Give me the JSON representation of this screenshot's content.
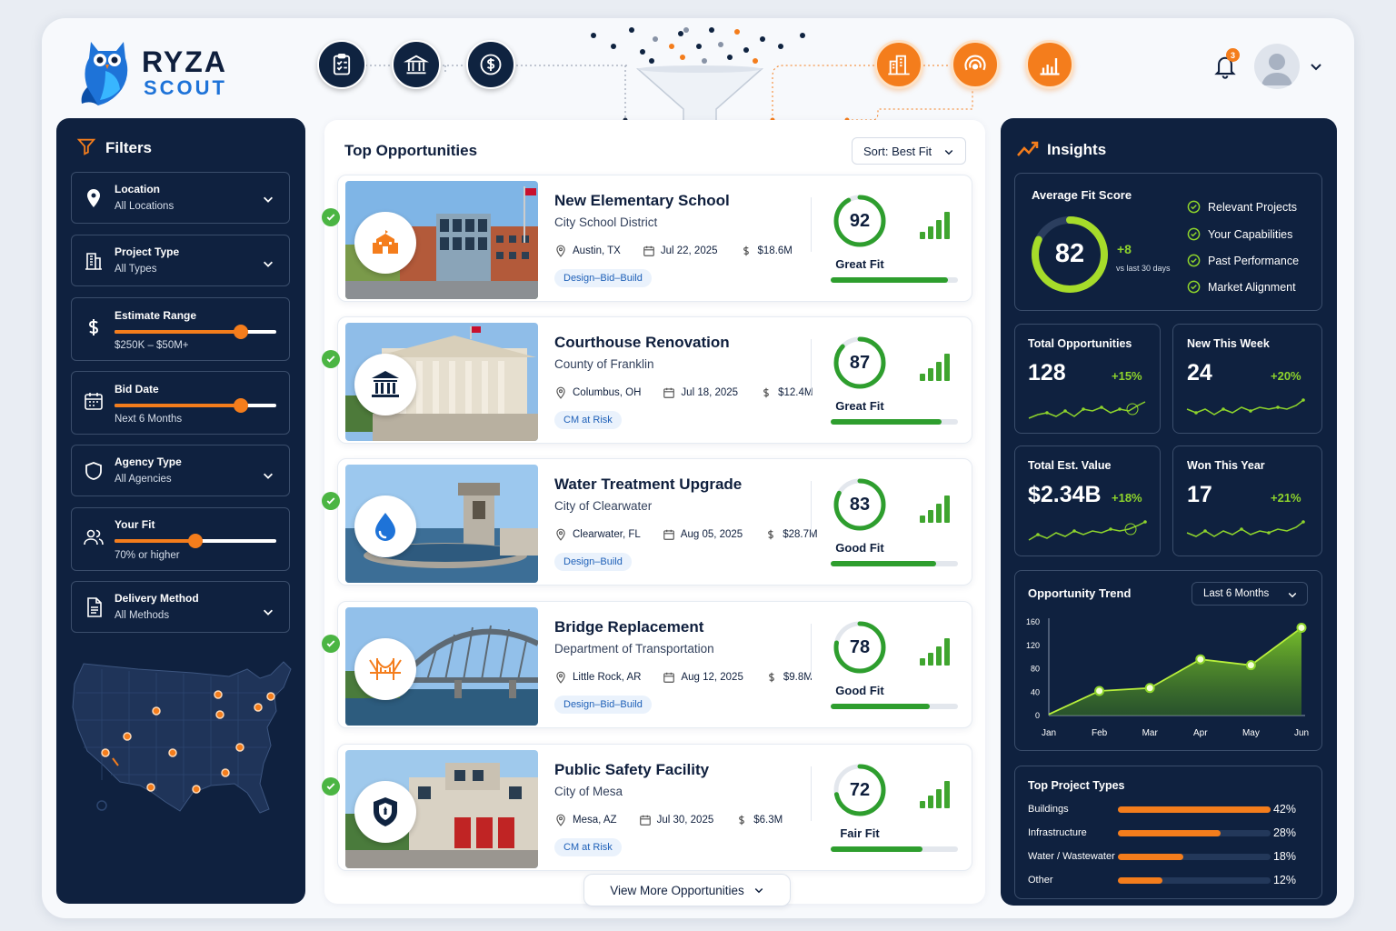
{
  "brand": {
    "name": "RYZA",
    "sub": "SCOUT"
  },
  "header": {
    "notifications_count": "3"
  },
  "filters": {
    "title": "Filters",
    "items": [
      {
        "label": "Location",
        "value": "All Locations"
      },
      {
        "label": "Project Type",
        "value": "All Types"
      },
      {
        "label": "Estimate Range",
        "value": "$250K – $50M+",
        "slider_position": 0.78
      },
      {
        "label": "Bid Date",
        "value": "Next 6 Months",
        "slider_position": 0.78
      },
      {
        "label": "Agency Type",
        "value": "All Agencies"
      },
      {
        "label": "Your Fit",
        "value": "70% or higher",
        "slider_position": 0.5
      },
      {
        "label": "Delivery Method",
        "value": "All Methods"
      }
    ]
  },
  "opportunities": {
    "title": "Top Opportunities",
    "sort_label": "Sort: Best Fit",
    "more_label": "View More Opportunities",
    "items": [
      {
        "title": "New Elementary School",
        "agency": "City School District",
        "location": "Austin, TX",
        "date": "Jul 22, 2025",
        "value": "$18.6M",
        "tag": "Design–Bid–Build",
        "score": 92,
        "fit": "Great Fit",
        "icon": "school-icon"
      },
      {
        "title": "Courthouse Renovation",
        "agency": "County of Franklin",
        "location": "Columbus, OH",
        "date": "Jul 18, 2025",
        "value": "$12.4M",
        "tag": "CM at Risk",
        "score": 87,
        "fit": "Great Fit",
        "icon": "courthouse-icon"
      },
      {
        "title": "Water Treatment Upgrade",
        "agency": "City of Clearwater",
        "location": "Clearwater, FL",
        "date": "Aug 05, 2025",
        "value": "$28.7M",
        "tag": "Design–Build",
        "score": 83,
        "fit": "Good Fit",
        "icon": "water-drop-icon"
      },
      {
        "title": "Bridge Replacement",
        "agency": "Department of Transportation",
        "location": "Little Rock, AR",
        "date": "Aug 12, 2025",
        "value": "$9.8M",
        "tag": "Design–Bid–Build",
        "score": 78,
        "fit": "Good Fit",
        "icon": "bridge-icon"
      },
      {
        "title": "Public Safety Facility",
        "agency": "City of Mesa",
        "location": "Mesa, AZ",
        "date": "Jul 30, 2025",
        "value": "$6.3M",
        "tag": "CM at Risk",
        "score": 72,
        "fit": "Fair Fit",
        "icon": "shield-icon"
      }
    ]
  },
  "insights": {
    "title": "Insights",
    "avg_fit": {
      "label": "Average Fit Score",
      "score": 82,
      "delta": "+8",
      "delta_note": "vs last 30 days"
    },
    "factors": [
      "Relevant Projects",
      "Your Capabilities",
      "Past Performance",
      "Market Alignment"
    ],
    "kpis": [
      {
        "label": "Total Opportunities",
        "value": "128",
        "delta": "+15%"
      },
      {
        "label": "New This Week",
        "value": "24",
        "delta": "+20%"
      },
      {
        "label": "Total Est. Value",
        "value": "$2.34B",
        "delta": "+18%"
      },
      {
        "label": "Won This Year",
        "value": "17",
        "delta": "+21%"
      }
    ],
    "trend": {
      "title": "Opportunity Trend",
      "range": "Last 6 Months"
    },
    "top_types": {
      "title": "Top Project Types",
      "items": [
        {
          "name": "Buildings",
          "pct": "42%"
        },
        {
          "name": "Infrastructure",
          "pct": "28%"
        },
        {
          "name": "Water / Wastewater",
          "pct": "18%"
        },
        {
          "name": "Other",
          "pct": "12%"
        }
      ]
    }
  },
  "chart_data": {
    "type": "area",
    "title": "Opportunity Trend",
    "categories": [
      "Jan",
      "Feb",
      "Mar",
      "Apr",
      "May",
      "Jun"
    ],
    "series": [
      {
        "values": [
          2,
          42,
          47,
          96,
          86,
          150
        ]
      }
    ],
    "ylim": [
      0,
      160
    ],
    "yticks": [
      0,
      40,
      80,
      120,
      160
    ]
  },
  "colors": {
    "accent": "#f47d1c",
    "navy": "#0f213f",
    "green": "#2e9e2e",
    "lime": "#8ed42c"
  }
}
